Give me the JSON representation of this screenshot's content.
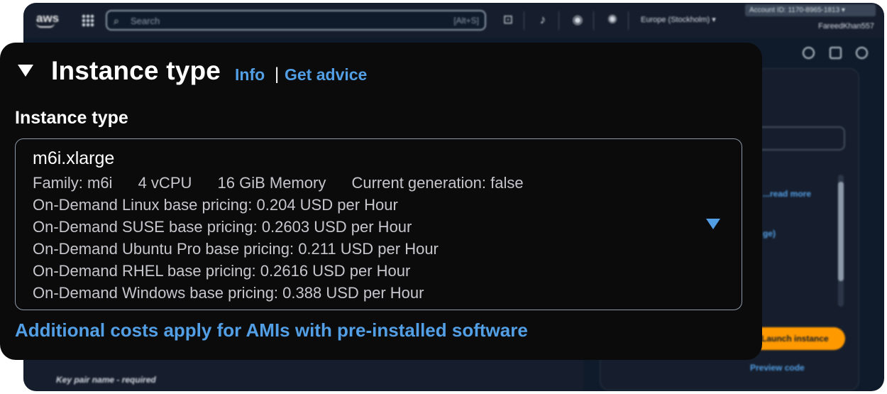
{
  "background": {
    "logo_text": "aws",
    "search_placeholder": "Search",
    "search_shortcut": "[Alt+S]",
    "region": "Europe (Stockholm) ▾",
    "account": "Account ID: 1170-8965-1813 ▾",
    "user": "FareedKhan557",
    "read_more": "...read more",
    "tooltip_link": "ge)",
    "launch_button": "Launch instance",
    "preview_code": "Preview code",
    "keypair_label": "Key pair name - required"
  },
  "section": {
    "title": "Instance type",
    "info_link": "Info",
    "separator": "|",
    "advice_link": "Get advice"
  },
  "field": {
    "label": "Instance type",
    "selected_value": "m6i.xlarge",
    "specs": [
      "Family: m6i",
      "4 vCPU",
      "16 GiB Memory",
      "Current generation: false"
    ],
    "pricing": [
      "On-Demand Linux base pricing: 0.204 USD per Hour",
      "On-Demand SUSE base pricing: 0.2603 USD per Hour",
      "On-Demand Ubuntu Pro base pricing: 0.211 USD per Hour",
      "On-Demand RHEL base pricing: 0.2616 USD per Hour",
      "On-Demand Windows base pricing: 0.388 USD per Hour"
    ]
  },
  "footer": {
    "costs_link": "Additional costs apply for AMIs with pre-installed software"
  },
  "colors": {
    "link": "#539fe5",
    "card_bg": "#0b0b0b",
    "console_bg": "#0f1b2a",
    "launch": "#ff9900"
  }
}
